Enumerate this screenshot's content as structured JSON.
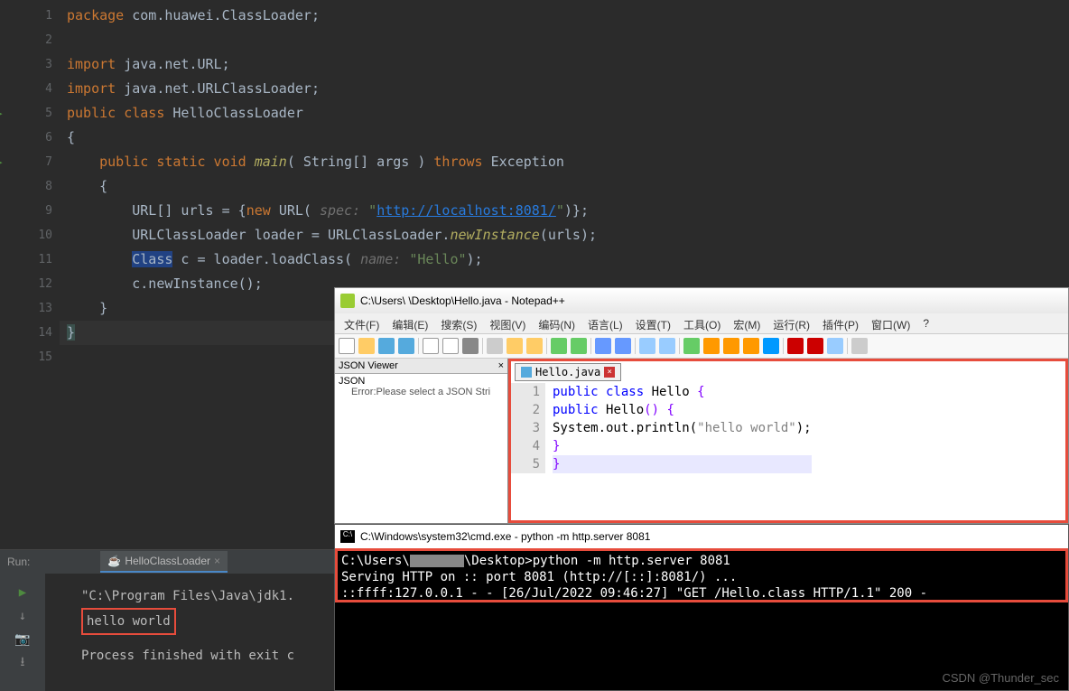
{
  "ide": {
    "lines": [
      "1",
      "2",
      "3",
      "4",
      "5",
      "6",
      "7",
      "8",
      "9",
      "10",
      "11",
      "12",
      "13",
      "14",
      "15"
    ],
    "code": {
      "l1": {
        "kw1": "package ",
        "pkg": "com.huawei.ClassLoader",
        "end": ";"
      },
      "l3": {
        "kw1": "import ",
        "pkg": "java.net.URL",
        "end": ";"
      },
      "l4": {
        "kw1": "import ",
        "pkg": "java.net.URLClassLoader",
        "end": ";"
      },
      "l5": {
        "kw1": "public class ",
        "name": "HelloClassLoader"
      },
      "l6": "{",
      "l7": {
        "kw": "    public static void ",
        "fn": "main",
        "sig": "( String[] args ) ",
        "kw2": "throws ",
        "ex": "Exception"
      },
      "l8": "    {",
      "l9": {
        "pre": "        URL[] urls = {",
        "kw": "new ",
        "cls": "URL( ",
        "param": "spec: ",
        "q": "\"",
        "url": "http://localhost:8081/",
        "q2": "\"",
        "end": ")};"
      },
      "l10": {
        "pre": "        URLClassLoader loader = URLClassLoader.",
        "fn": "newInstance",
        "end": "(urls);"
      },
      "l11": {
        "pre": "        ",
        "sel": "Class",
        "mid": " c = loader.loadClass( ",
        "param": "name: ",
        "str": "\"Hello\"",
        "end": ");"
      },
      "l12": "        c.newInstance();",
      "l13": "    }",
      "l14": "}"
    }
  },
  "run": {
    "label": "Run:",
    "tab": "HelloClassLoader",
    "line1": "\"C:\\Program Files\\Java\\jdk1.",
    "line2": "hello world",
    "line3": "Process finished with exit c"
  },
  "npp": {
    "title": "C:\\Users\\          \\Desktop\\Hello.java - Notepad++",
    "menu": [
      "文件(F)",
      "编辑(E)",
      "搜索(S)",
      "视图(V)",
      "编码(N)",
      "语言(L)",
      "设置(T)",
      "工具(O)",
      "宏(M)",
      "运行(R)",
      "插件(P)",
      "窗口(W)",
      "?"
    ],
    "side_title": "JSON Viewer",
    "side_root": "JSON",
    "side_err": "Error:Please select a JSON Stri",
    "tab": "Hello.java",
    "ed_nums": [
      "1",
      "2",
      "3",
      "4",
      "5"
    ],
    "ed": {
      "l1": {
        "kw": "public class ",
        "n": "Hello ",
        "b": "{"
      },
      "l2": {
        "pad": "    ",
        "kw": "public ",
        "n": "Hello",
        "sig": "() ",
        "b": "{"
      },
      "l3": {
        "pad": "        ",
        "call": "System.out.println(",
        "s": "\"hello world\"",
        "end": ");"
      },
      "l4": "    }",
      "l5": "}"
    }
  },
  "cmd": {
    "title": "C:\\Windows\\system32\\cmd.exe - python  -m http.server 8081",
    "l1a": "C:\\Users\\",
    "l1b": "\\Desktop>python -m http.server 8081",
    "l2": "Serving HTTP on :: port 8081 (http://[::]:8081/) ...",
    "l3": "::ffff:127.0.0.1 - - [26/Jul/2022 09:46:27] \"GET /Hello.class HTTP/1.1\" 200 -"
  },
  "watermark": "CSDN @Thunder_sec"
}
